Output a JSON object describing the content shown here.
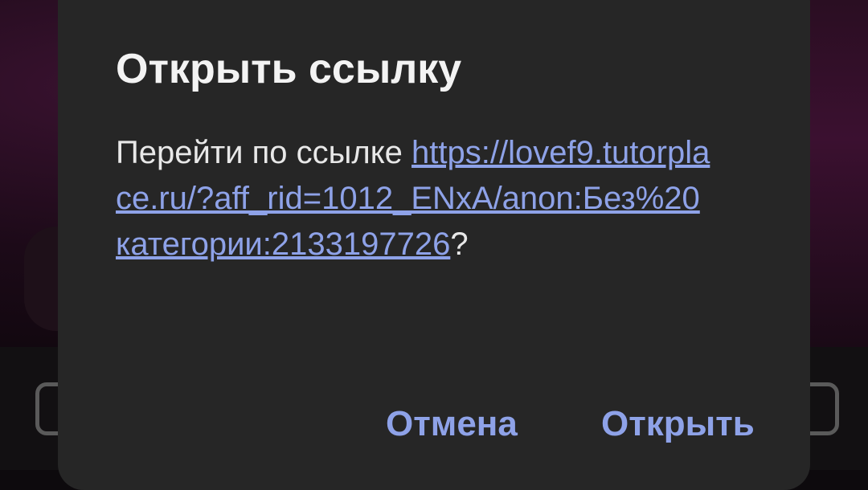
{
  "dialog": {
    "title": "Открыть ссылку",
    "message_prefix": "Перейти по ссылке ",
    "url": "https://lovef9.tutorplace.ru/?aff_rid=1012_ENxA/anon:Без%20категории:2133197726",
    "message_suffix": "?",
    "cancel_label": "Отмена",
    "open_label": "Открыть"
  },
  "colors": {
    "dialog_background": "#262626",
    "accent": "#8ea2e8",
    "title_text": "#f3f3f3",
    "body_text": "#e8e8e8"
  }
}
